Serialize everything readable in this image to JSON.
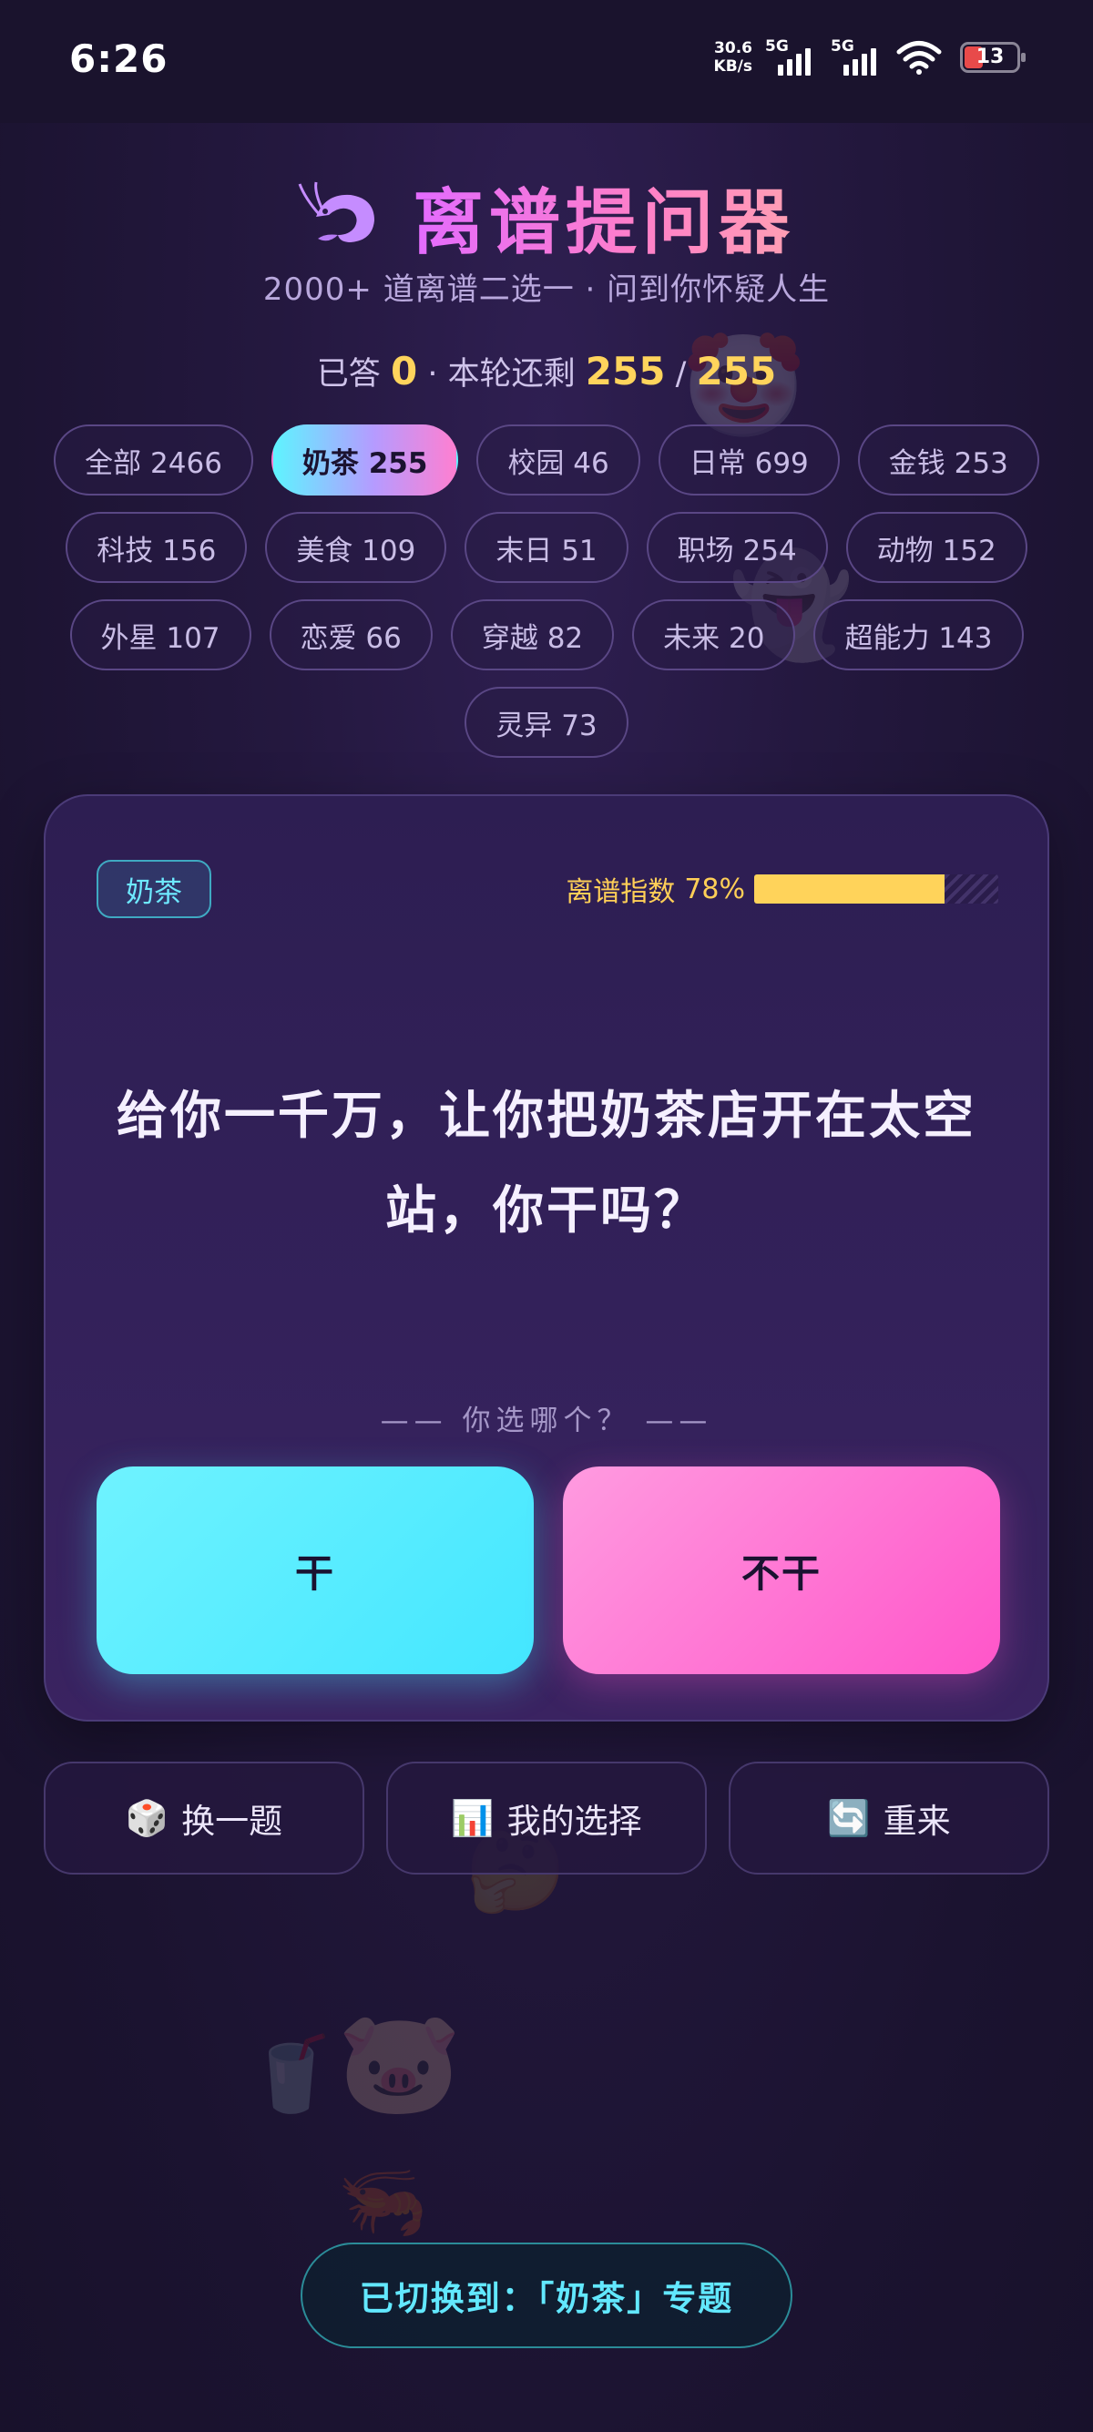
{
  "status_bar": {
    "time": "6:26",
    "net_speed_value": "30.6",
    "net_speed_unit": "KB/s",
    "signal1_label": "5G",
    "signal2_label": "5G",
    "battery_level": "13",
    "battery_color": "#e84a4a"
  },
  "header": {
    "icon": "shrimp-icon",
    "title": "离谱提问器",
    "subtitle": "2000+ 道离谱二选一 · 问到你怀疑人生"
  },
  "progress": {
    "answered_label": "已答",
    "answered": "0",
    "separator": "·",
    "remaining_label": "本轮还剩",
    "remaining": "255",
    "slash": "/",
    "total": "255"
  },
  "categories": [
    {
      "label": "全部 2466",
      "active": false
    },
    {
      "label": "奶茶 255",
      "active": true
    },
    {
      "label": "校园 46",
      "active": false
    },
    {
      "label": "日常 699",
      "active": false
    },
    {
      "label": "金钱 253",
      "active": false
    },
    {
      "label": "科技 156",
      "active": false
    },
    {
      "label": "美食 109",
      "active": false
    },
    {
      "label": "末日 51",
      "active": false
    },
    {
      "label": "职场 254",
      "active": false
    },
    {
      "label": "动物 152",
      "active": false
    },
    {
      "label": "外星 107",
      "active": false
    },
    {
      "label": "恋爱 66",
      "active": false
    },
    {
      "label": "穿越 82",
      "active": false
    },
    {
      "label": "未来 20",
      "active": false
    },
    {
      "label": "超能力 143",
      "active": false
    },
    {
      "label": "灵异 73",
      "active": false
    }
  ],
  "card": {
    "tag": "奶茶",
    "absurd_label": "离谱指数",
    "absurd_percent_text": "78%",
    "absurd_value": 0.78,
    "question": "给你一千万，让你把奶茶店开在太空站，你干吗？",
    "hint": "—— 你选哪个？ ——",
    "option_yes": "干",
    "option_no": "不干"
  },
  "actions": {
    "next": {
      "icon": "dice-icon",
      "label": "换一题"
    },
    "my_choices": {
      "icon": "bar-chart-icon",
      "label": "我的选择"
    },
    "restart": {
      "icon": "refresh-icon",
      "label": "重来"
    }
  },
  "toast": {
    "text": "已切换到：「奶茶」专题"
  },
  "colors": {
    "accent_yellow": "#ffd45c",
    "accent_cyan": "#43e6ff",
    "accent_pink": "#ff55c9",
    "title_gradient_start": "#e36bff",
    "title_gradient_end": "#ff9fb3"
  }
}
